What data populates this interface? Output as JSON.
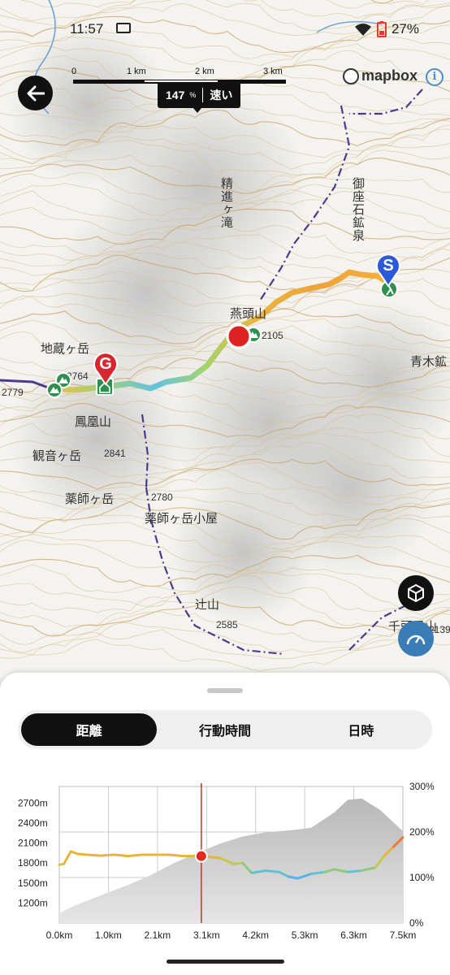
{
  "status_bar": {
    "time": "11:57",
    "battery": "27%"
  },
  "map": {
    "scale": {
      "labels": [
        "0",
        "1 km",
        "2 km",
        "3 km"
      ]
    },
    "attribution": "mapbox",
    "labels": {
      "shojin_taki": "精進ヶ滝",
      "gozaishi_onsen": "御座石鉱泉",
      "enogatou": "燕頭山",
      "peak_2105": "2105",
      "aoki": "青木鉱",
      "jizo": "地蔵ヶ岳",
      "p2764": "2764",
      "p2779": "2779",
      "hoo": "鳳凰山",
      "kannon": "観音ヶ岳",
      "p2841": "2841",
      "yakushi": "薬師ヶ岳",
      "p2780": "2780",
      "yakushi_hut": "薬師ヶ岳小屋",
      "tsujiyama": "辻山",
      "p2585": "2585",
      "senzu": "千頭星山",
      "p2139": "2139"
    },
    "markers": {
      "start": "S",
      "goal": "G"
    }
  },
  "sheet": {
    "tabs": [
      {
        "label": "距離",
        "active": true
      },
      {
        "label": "行動時間",
        "active": false
      },
      {
        "label": "日時",
        "active": false
      }
    ],
    "tooltip": {
      "value": "147",
      "unit": "%",
      "speed_label": "速い"
    }
  },
  "colors": {
    "route_fast": "#e0403a",
    "route_slow": "#5ab8e8",
    "accent": "#111111",
    "cursor": "#dd2a22"
  },
  "chart_data": {
    "type": "area",
    "x_ticks": [
      "0.0km",
      "1.0km",
      "2.1km",
      "3.1km",
      "4.2km",
      "5.3km",
      "6.3km",
      "7.5km"
    ],
    "x_range": [
      0,
      7.5
    ],
    "left_axis": {
      "ticks": [
        "1200m",
        "1500m",
        "1800m",
        "2100m",
        "2400m",
        "2700m"
      ],
      "range": [
        900,
        2950
      ]
    },
    "right_axis": {
      "ticks": [
        "0%",
        "100%",
        "200%",
        "300%"
      ],
      "range": [
        0,
        300
      ]
    },
    "elevation": {
      "x": [
        0.0,
        0.3,
        0.7,
        1.0,
        1.5,
        2.0,
        2.5,
        3.0,
        3.5,
        4.0,
        4.5,
        5.0,
        5.5,
        6.0,
        6.3,
        6.6,
        7.0,
        7.5
      ],
      "y": [
        1050,
        1150,
        1260,
        1340,
        1470,
        1620,
        1800,
        1950,
        2090,
        2200,
        2260,
        2290,
        2330,
        2560,
        2750,
        2770,
        2600,
        2280
      ]
    },
    "speed": {
      "x": [
        0.0,
        0.1,
        0.25,
        0.4,
        0.6,
        0.9,
        1.2,
        1.5,
        1.8,
        2.0,
        2.4,
        2.7,
        3.0,
        3.1,
        3.5,
        3.8,
        4.0,
        4.2,
        4.5,
        4.8,
        5.0,
        5.2,
        5.5,
        5.8,
        6.0,
        6.3,
        6.6,
        6.9,
        7.1,
        7.3,
        7.5
      ],
      "y": [
        128,
        130,
        157,
        152,
        150,
        148,
        150,
        147,
        150,
        150,
        150,
        147,
        147,
        147,
        143,
        130,
        132,
        110,
        115,
        112,
        102,
        98,
        108,
        112,
        118,
        112,
        115,
        122,
        148,
        168,
        188
      ]
    },
    "cursor": {
      "x": 3.1,
      "speed": 147
    },
    "grid": true
  }
}
